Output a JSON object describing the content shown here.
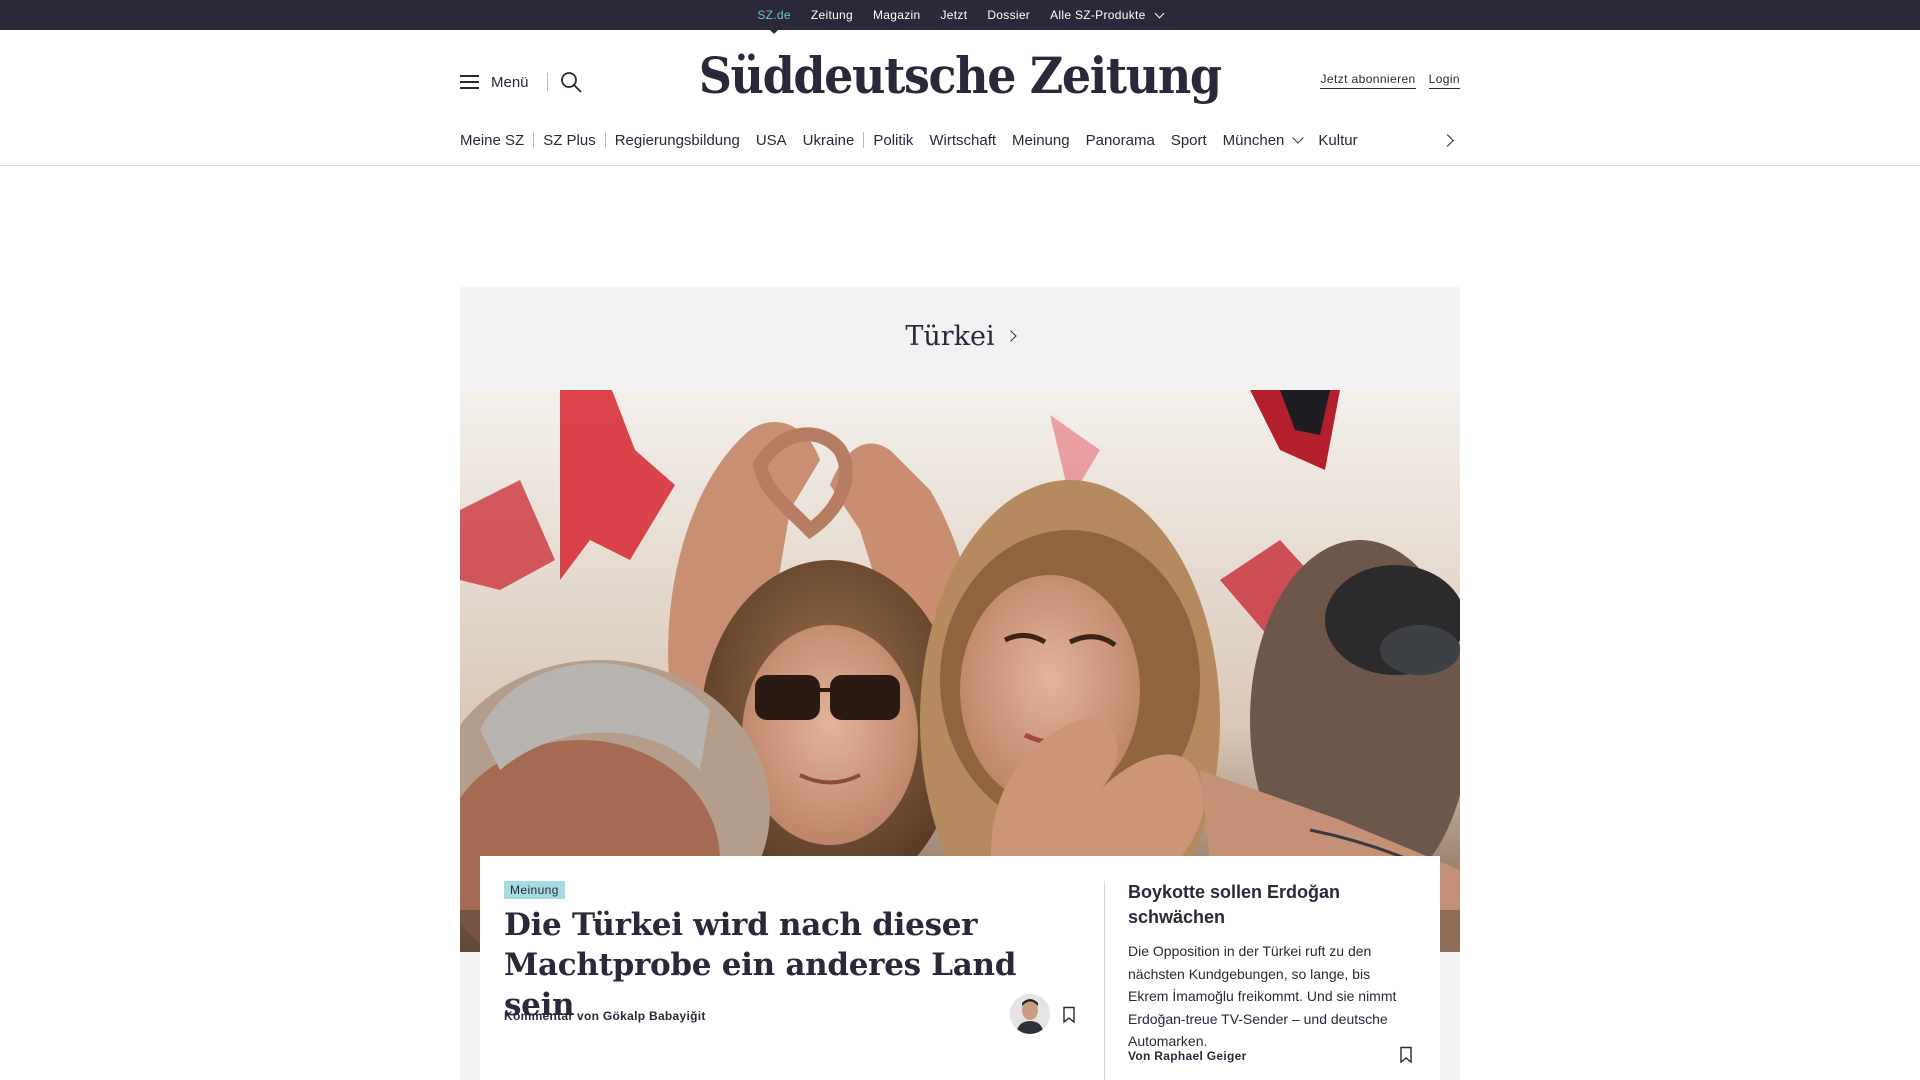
{
  "topbar": {
    "items": [
      {
        "label": "SZ.de",
        "active": true
      },
      {
        "label": "Zeitung"
      },
      {
        "label": "Magazin"
      },
      {
        "label": "Jetzt"
      },
      {
        "label": "Dossier"
      },
      {
        "label": "Alle SZ-Produkte",
        "dropdown": true
      }
    ]
  },
  "header": {
    "menu_label": "Menü",
    "logo": "Süddeutsche Zeitung",
    "subscribe_label": "Jetzt abonnieren",
    "login_label": "Login"
  },
  "nav": {
    "items": [
      "Meine SZ",
      "SZ Plus",
      "Regierungsbildung",
      "USA",
      "Ukraine",
      "Politik",
      "Wirtschaft",
      "Meinung",
      "Panorama",
      "Sport",
      "München",
      "Kultur"
    ]
  },
  "topic": {
    "title": "Türkei",
    "main_article": {
      "badge": "Meinung",
      "headline": "Die Türkei wird nach dieser Machtprobe ein anderes Land sein",
      "byline": "Kommentar von Gökalp Babayiğit"
    },
    "side_article": {
      "headline": "Boykotte sollen Erdoğan schwächen",
      "text": "Die Opposition in der Türkei ruft zu den nächsten Kundgebungen, so lange, bis Ekrem İmamoğlu freikommt. Und sie nimmt Erdoğan-treue TV-Sender – und deutsche Automarken.",
      "byline": "Von Raphael Geiger"
    }
  },
  "colors": {
    "topbar_bg": "#29293a",
    "active_link": "#71c3cf",
    "badge_bg": "#a7dbe1",
    "topic_bg": "#f2f2f2"
  }
}
